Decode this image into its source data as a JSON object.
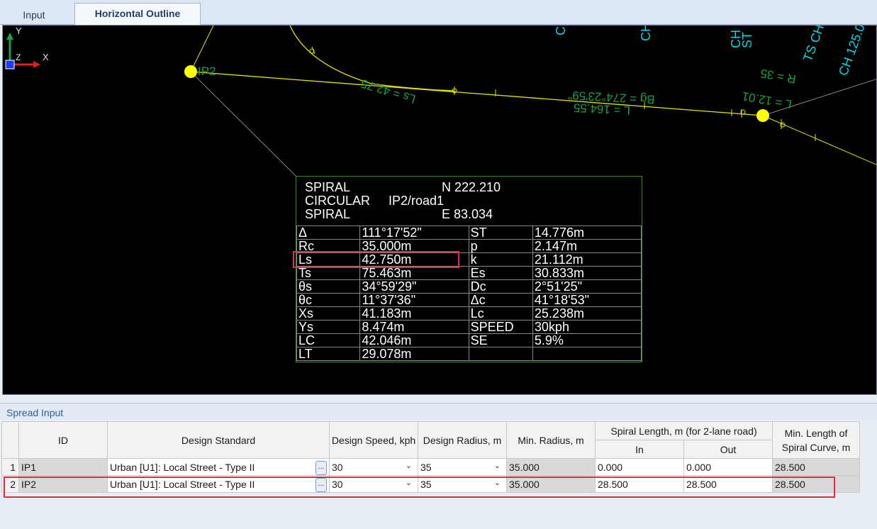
{
  "tabs": [
    {
      "label": "Input",
      "active": false
    },
    {
      "label": "Horizontal Outline",
      "active": true
    }
  ],
  "viewport": {
    "labels": {
      "ip2": "IP2",
      "ls": "Ls = 42.75",
      "bearing": "Bg = 274°23'59\"",
      "length": "L = 164.55",
      "r": "R = 35",
      "l2": "L = 12.01",
      "ch1": "CH",
      "ch2": "CH",
      "chst": "CH",
      "st": "ST",
      "tsch": "TS CH",
      "ch125": "CH 125.0",
      "cut1": "C"
    },
    "info": {
      "line1_left": "SPIRAL",
      "line1_right": "N 222.210",
      "line2_left": "CIRCULAR",
      "line2_right": "IP2/road1",
      "line3_left": "SPIRAL",
      "line3_right": "E 83.034",
      "rows": [
        [
          "Δ",
          "111°17'52\"",
          "ST",
          "14.776m"
        ],
        [
          "Rc",
          "35.000m",
          "p",
          "2.147m"
        ],
        [
          "Ls",
          "42.750m",
          "k",
          "21.112m"
        ],
        [
          "Ts",
          "75.463m",
          "Es",
          "30.833m"
        ],
        [
          "θs",
          "34°59'29\"",
          "Dc",
          "2°51'25\""
        ],
        [
          "θc",
          "11°37'36\"",
          "Δc",
          "41°18'53\""
        ],
        [
          "Xs",
          "41.183m",
          "Lc",
          "25.238m"
        ],
        [
          "Ys",
          "8.474m",
          "SPEED",
          "30kph"
        ],
        [
          "LC",
          "42.046m",
          "SE",
          "5.9%"
        ],
        [
          "LT",
          "29.078m",
          "",
          ""
        ]
      ]
    },
    "axis": {
      "y": "Y",
      "z": "Z",
      "x": "X"
    }
  },
  "spread": {
    "title": "Spread Input",
    "headers": {
      "id": "ID",
      "standard": "Design Standard",
      "speed": "Design Speed, kph",
      "radius": "Design Radius, m",
      "minradius": "Min. Radius, m",
      "spiral": "Spiral Length, m (for 2-lane road)",
      "in": "In",
      "out": "Out",
      "minlen": "Min. Length of Spiral Curve, m"
    },
    "ellipsis": "...",
    "rows": [
      {
        "num": "1",
        "id": "IP1",
        "standard": "Urban [U1]: Local Street - Type II",
        "speed": "30",
        "radius": "35",
        "minradius": "35.000",
        "in": "0.000",
        "out": "0.000",
        "minlen": "28.500"
      },
      {
        "num": "2",
        "id": "IP2",
        "standard": "Urban [U1]: Local Street - Type II",
        "speed": "30",
        "radius": "35",
        "minradius": "35.000",
        "in": "28.500",
        "out": "28.500",
        "minlen": "28.500"
      }
    ]
  }
}
